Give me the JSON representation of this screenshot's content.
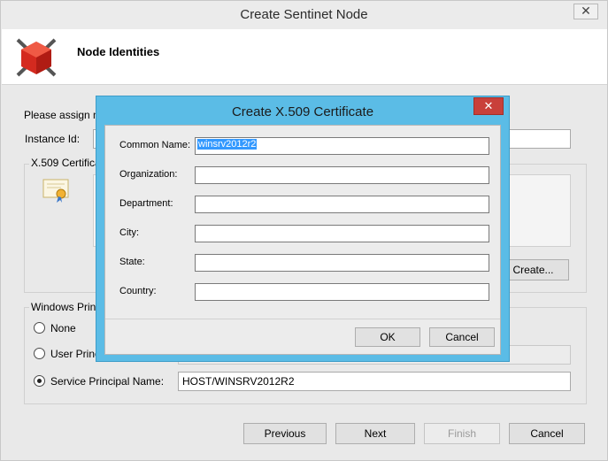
{
  "window": {
    "title": "Create Sentinet Node",
    "close_glyph": "✕"
  },
  "header": {
    "title": "Node Identities",
    "logo_icon": "sentinet-logo-icon"
  },
  "main": {
    "intro_text": "Please assign no",
    "instance_id_label": "Instance Id:",
    "instance_id_value": "",
    "x509_group_label": "X.509 Certifica",
    "create_button_label": "Create...",
    "windows_group_label": "Windows Princ",
    "radio_none_label": "None",
    "radio_user_label": "User Princ",
    "radio_spn_label": "Service Principal Name:",
    "spn_value": "HOST/WINSRV2012R2",
    "user_principal_value": ""
  },
  "footer": {
    "previous_label": "Previous",
    "next_label": "Next",
    "finish_label": "Finish",
    "cancel_label": "Cancel"
  },
  "dialog": {
    "title": "Create X.509 Certificate",
    "close_glyph": "✕",
    "fields": [
      {
        "label": "Common Name:",
        "value": "winsrv2012r2"
      },
      {
        "label": "Organization:",
        "value": ""
      },
      {
        "label": "Department:",
        "value": ""
      },
      {
        "label": "City:",
        "value": ""
      },
      {
        "label": "State:",
        "value": ""
      },
      {
        "label": "Country:",
        "value": ""
      }
    ],
    "ok_label": "OK",
    "cancel_label": "Cancel"
  },
  "colors": {
    "dialog_border": "#5bbce6",
    "dialog_close": "#c9403a",
    "selection": "#3399ff"
  }
}
